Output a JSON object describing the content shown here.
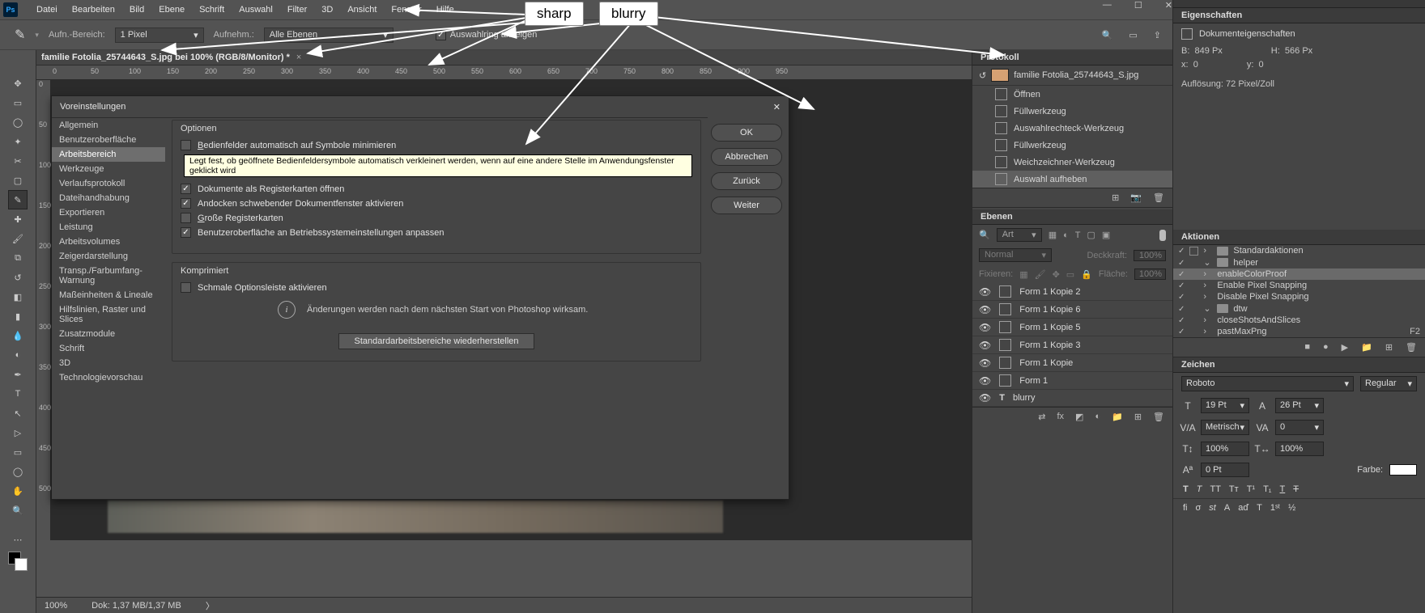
{
  "menubar": [
    "Datei",
    "Bearbeiten",
    "Bild",
    "Ebene",
    "Schrift",
    "Auswahl",
    "Filter",
    "3D",
    "Ansicht",
    "Fenster",
    "Hilfe"
  ],
  "optbar": {
    "aufn_bereich_label": "Aufn.-Bereich:",
    "aufn_bereich_value": "1 Pixel",
    "aufnehm_label": "Aufnehm.:",
    "aufnehm_value": "Alle Ebenen",
    "show_ring": "Auswahlring anzeigen"
  },
  "doc_tab": "familie Fotolia_25744643_S.jpg bei 100% (RGB/8/Monitor) *",
  "ruler_h": [
    0,
    50,
    100,
    150,
    200,
    250,
    300,
    350,
    400,
    450,
    500,
    550,
    600,
    650,
    700,
    750,
    800,
    850,
    900,
    950
  ],
  "ruler_v": [
    0,
    50,
    100,
    150,
    200,
    250,
    300,
    350,
    400,
    450,
    500
  ],
  "pref": {
    "title": "Voreinstellungen",
    "side": [
      "Allgemein",
      "Benutzeroberfläche",
      "Arbeitsbereich",
      "Werkzeuge",
      "Verlaufsprotokoll",
      "Dateihandhabung",
      "Exportieren",
      "Leistung",
      "Arbeitsvolumes",
      "Zeigerdarstellung",
      "Transp./Farbumfang-Warnung",
      "Maßeinheiten & Lineale",
      "Hilfslinien, Raster und Slices",
      "Zusatzmodule",
      "Schrift",
      "3D",
      "Technologievorschau"
    ],
    "side_selected_index": 2,
    "group1_title": "Optionen",
    "opt_min": "Bedienfelder automatisch auf Symbole minimieren",
    "tooltip": "Legt fest, ob geöffnete Bedienfeldersymbole automatisch verkleinert werden, wenn auf eine andere Stelle im Anwendungsfenster geklickt wird",
    "opt_tabs": "Dokumente als Registerkarten öffnen",
    "opt_dock": "Andocken schwebender Dokumentfenster aktivieren",
    "opt_big": "Große Registerkarten",
    "opt_os": "Benutzeroberfläche an Betriebssystemeinstellungen anpassen",
    "group2_title": "Komprimiert",
    "opt_narrow": "Schmale Optionsleiste aktivieren",
    "info": "Änderungen werden nach dem nächsten Start von Photoshop wirksam.",
    "restore": "Standardarbeitsbereiche wiederherstellen",
    "btn_ok": "OK",
    "btn_cancel": "Abbrechen",
    "btn_back": "Zurück",
    "btn_next": "Weiter"
  },
  "protokoll": {
    "title": "Protokoll",
    "file": "familie Fotolia_25744643_S.jpg",
    "items": [
      "Öffnen",
      "Füllwerkzeug",
      "Auswahlrechteck-Werkzeug",
      "Füllwerkzeug",
      "Weichzeichner-Werkzeug",
      "Auswahl aufheben"
    ]
  },
  "ebenen": {
    "title": "Ebenen",
    "filter": "Art",
    "blend": "Normal",
    "opacity_label": "Deckkraft:",
    "opacity": "100%",
    "lock_label": "Fixieren:",
    "fill_label": "Fläche:",
    "fill": "100%",
    "layers": [
      "Form 1 Kopie 2",
      "Form 1 Kopie 6",
      "Form 1 Kopie 5",
      "Form 1 Kopie 3",
      "Form 1 Kopie",
      "Form 1",
      "blurry"
    ]
  },
  "properties": {
    "title": "Eigenschaften",
    "sub": "Dokumenteigenschaften",
    "w_label": "B:",
    "w": "849 Px",
    "h_label": "H:",
    "h": "566 Px",
    "x_label": "x:",
    "x": "0",
    "y_label": "y:",
    "y": "0",
    "res_label": "Auflösung:",
    "res": "72 Pixel/Zoll"
  },
  "aktionen": {
    "title": "Aktionen",
    "standard": "Standardaktionen",
    "helper": "helper",
    "helper_items": [
      "enableColorProof",
      "Enable Pixel Snapping",
      "Disable Pixel Snapping"
    ],
    "dtw": "dtw",
    "dtw_items": [
      {
        "name": "closeShotsAndSlices",
        "key": ""
      },
      {
        "name": "pastMaxPng",
        "key": "F2"
      }
    ]
  },
  "zeichen": {
    "title": "Zeichen",
    "font": "Roboto",
    "weight": "Regular",
    "size": "19 Pt",
    "leading": "26 Pt",
    "kerning": "Metrisch",
    "tracking": "0",
    "vscale": "100%",
    "hscale": "100%",
    "baseline": "0 Pt",
    "color_label": "Farbe:"
  },
  "status": {
    "zoom": "100%",
    "doc": "Dok: 1,37 MB/1,37 MB"
  },
  "callouts": {
    "sharp": "sharp",
    "blurry": "blurry"
  }
}
